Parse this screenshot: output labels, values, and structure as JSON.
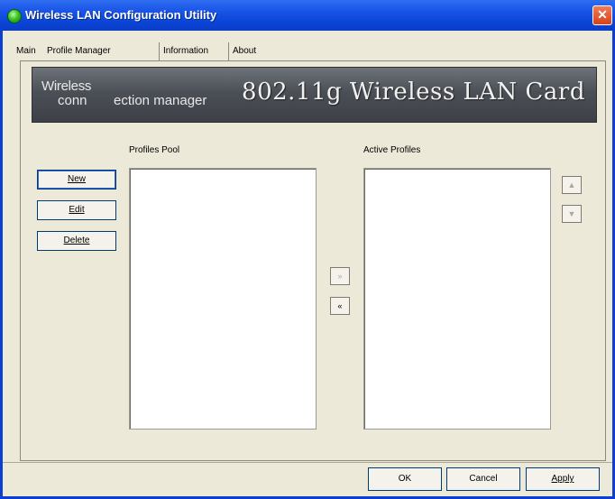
{
  "window": {
    "title": "Wireless LAN Configuration Utility",
    "close_symbol": "✕"
  },
  "tabs": [
    {
      "label": "Main"
    },
    {
      "label": "Profile Manager"
    },
    {
      "label": "Information"
    },
    {
      "label": "About"
    }
  ],
  "banner": {
    "line1": "Wireless",
    "line2_prefix": "conn",
    "line2_suffix": "ection manager",
    "product": "802.11g Wireless LAN Card"
  },
  "profiles_pool": {
    "label": "Profiles Pool",
    "items": []
  },
  "active_profiles": {
    "label": "Active Profiles",
    "items": []
  },
  "buttons": {
    "new": "New",
    "edit": "Edit",
    "delete": "Delete",
    "add_all": "»",
    "remove_all": "«",
    "move_up": "▲",
    "move_down": "▼",
    "ok": "OK",
    "cancel": "Cancel",
    "apply": "Apply"
  },
  "colors": {
    "title_bar": "#0a46d8",
    "dialog_bg": "#ece9d8",
    "banner": "#4b4f56"
  }
}
